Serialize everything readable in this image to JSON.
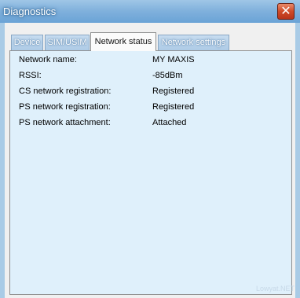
{
  "window": {
    "title": "Diagnostics",
    "close_glyph": "✕"
  },
  "tabs": [
    {
      "label": "Device"
    },
    {
      "label": "SIM/USIM"
    },
    {
      "label": "Network status"
    },
    {
      "label": "Network settings"
    }
  ],
  "network_status": {
    "rows": [
      {
        "label": "Network name:",
        "value": "MY MAXIS"
      },
      {
        "label": "RSSI:",
        "value": "-85dBm"
      },
      {
        "label": "CS network registration:",
        "value": "Registered"
      },
      {
        "label": "PS network registration:",
        "value": "Registered"
      },
      {
        "label": "PS network attachment:",
        "value": "Attached"
      }
    ]
  },
  "watermark": "Lowyat.NET"
}
